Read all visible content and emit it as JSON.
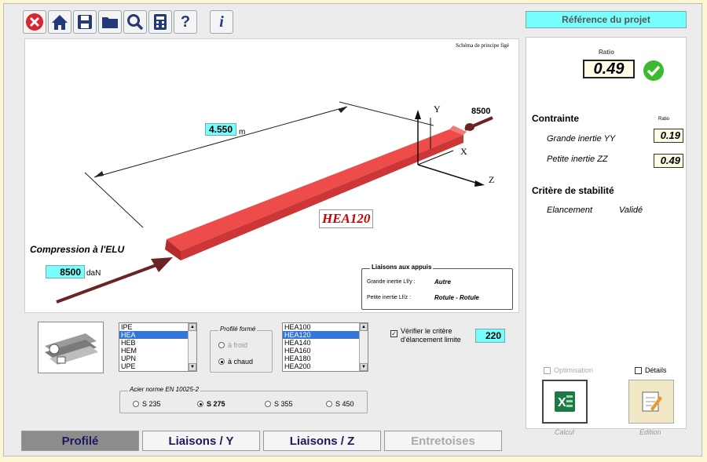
{
  "toolbar": {
    "icons": [
      "close-icon",
      "home-icon",
      "save-icon",
      "folder-icon",
      "search-icon",
      "calculator-icon",
      "help-icon",
      "info-icon"
    ],
    "help_label": "?",
    "info_label": "i"
  },
  "project": {
    "ref_label": "Référence du projet"
  },
  "drawing": {
    "schema_note": "Schéma de principe figé",
    "length_value": "4.550",
    "length_unit": "m",
    "profile_name": "HEA120",
    "force_top": "8500",
    "axis_y": "Y",
    "axis_x": "X",
    "axis_z": "Z",
    "compression_label": "Compression à l'ELU",
    "force_value": "8500",
    "force_unit": "daN",
    "liaisons": {
      "title": "Liaisons aux appuis",
      "grande_label": "Grande inertie  Lf/y :",
      "grande_value": "Autre",
      "petite_label": "Petite inertie  Lf/z :",
      "petite_value": "Rotule - Rotule"
    }
  },
  "profile_types": {
    "items": [
      "IPE",
      "HEA",
      "HEB",
      "HEM",
      "UPN",
      "UPE"
    ],
    "selected": "HEA"
  },
  "profil_forme": {
    "title": "Profilé formé",
    "froid": "à froid",
    "chaud": "à chaud"
  },
  "sizes": {
    "items": [
      "HEA100",
      "HEA120",
      "HEA140",
      "HEA160",
      "HEA180",
      "HEA200"
    ],
    "selected": "HEA120"
  },
  "verifier": {
    "label_line1": "Vérifier le critère",
    "label_line2": "d'élancement limite",
    "value": "220"
  },
  "acier": {
    "title": "Acier norme EN 10025-2",
    "options": [
      "S 235",
      "S 275",
      "S 355",
      "S 450"
    ],
    "selected": "S 275"
  },
  "tabs": [
    "Profilé",
    "Liaisons / Y",
    "Liaisons / Z",
    "Entretoises"
  ],
  "results": {
    "ratio_label": "Ratio",
    "ratio_value": "0.49",
    "contrainte_title": "Contrainte",
    "ratio_small": "Ratio",
    "grande_label": "Grande inertie YY",
    "grande_value": "0.19",
    "petite_label": "Petite inertie ZZ",
    "petite_value": "0.49",
    "stabilite_title": "Critère de stabilité",
    "elancement_label": "Elancement",
    "elancement_value": "Validé",
    "optimisation_label": "Optimisation",
    "details_label": "Détails",
    "calcul_label": "Calcul",
    "edition_label": "Edition"
  },
  "colors": {
    "accent_cyan": "#7fffff",
    "beam_red": "#ee4b4b",
    "ok_green": "#3dbb2f"
  }
}
